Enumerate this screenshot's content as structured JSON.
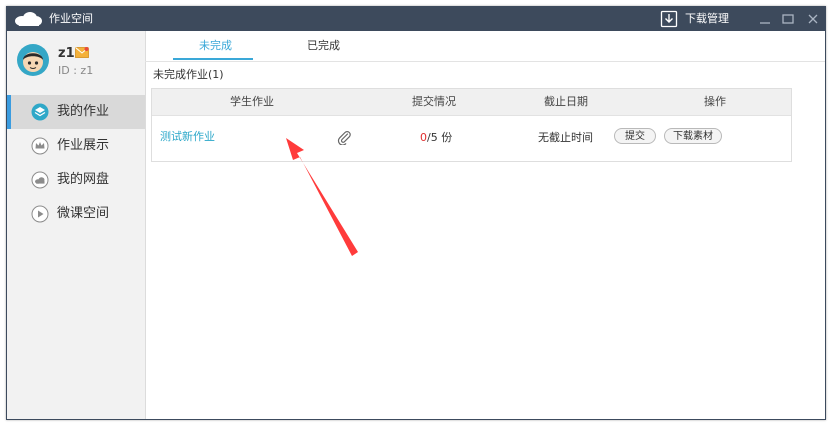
{
  "window": {
    "title": "作业空间",
    "download_manager": "下载管理"
  },
  "user": {
    "name": "z1",
    "id_text": "ID : z1"
  },
  "sidebar": {
    "items": [
      {
        "label": "我的作业",
        "icon": "layers-icon",
        "active": true
      },
      {
        "label": "作业展示",
        "icon": "crown-icon",
        "active": false
      },
      {
        "label": "我的网盘",
        "icon": "cloud-icon",
        "active": false
      },
      {
        "label": "微课空间",
        "icon": "play-icon",
        "active": false
      }
    ]
  },
  "tabs": [
    {
      "label": "未完成",
      "active": true
    },
    {
      "label": "已完成",
      "active": false
    }
  ],
  "section_title": "未完成作业(1)",
  "table": {
    "headers": [
      "学生作业",
      "提交情况",
      "截止日期",
      "操作"
    ],
    "rows": [
      {
        "name": "测试新作业",
        "submitted": "0",
        "total": "/5 份",
        "deadline": "无截止时间",
        "actions": [
          "提交",
          "下载素材"
        ]
      }
    ]
  },
  "colors": {
    "titlebar": "#3d4a5c",
    "accent": "#3aa8d8",
    "link": "#2aa7c9",
    "highlight_red": "#e03030",
    "annotation_arrow": "#ff3b3b"
  }
}
